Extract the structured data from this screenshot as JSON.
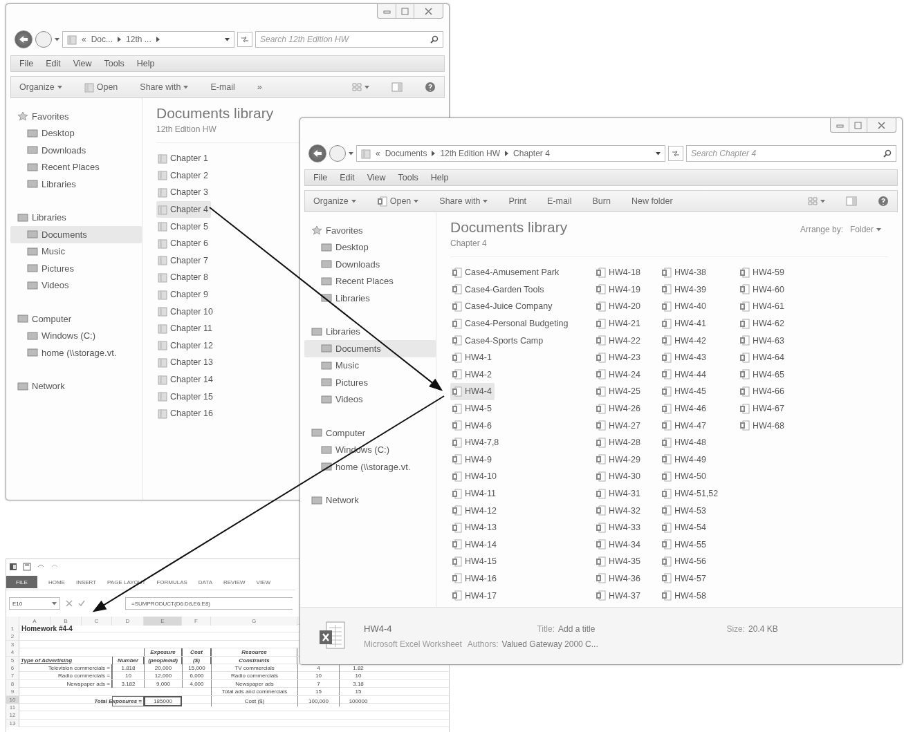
{
  "explorer_windows": [
    {
      "address": {
        "overflow": "«",
        "parts": [
          "Doc...",
          "12th ..."
        ],
        "trailing_separator": true
      },
      "search": {
        "placeholder": "Search 12th Edition HW"
      },
      "menu": [
        "File",
        "Edit",
        "View",
        "Tools",
        "Help"
      ],
      "toolbar": [
        {
          "label": "Organize",
          "dropdown": true,
          "kind": "plain"
        },
        {
          "label": "Open",
          "dropdown": false,
          "kind": "folder"
        },
        {
          "label": "Share with",
          "dropdown": true,
          "kind": "plain"
        },
        {
          "label": "E-mail",
          "dropdown": false,
          "kind": "plain"
        },
        {
          "label": "»",
          "dropdown": false,
          "kind": "plain"
        }
      ],
      "nav_groups": [
        {
          "label": "Favorites",
          "selected": false,
          "items": [
            {
              "label": "Desktop",
              "selected": false
            },
            {
              "label": "Downloads",
              "selected": false
            },
            {
              "label": "Recent Places",
              "selected": false
            },
            {
              "label": "Libraries",
              "selected": false
            }
          ]
        },
        {
          "label": "Libraries",
          "selected": false,
          "items": [
            {
              "label": "Documents",
              "selected": true
            },
            {
              "label": "Music",
              "selected": false
            },
            {
              "label": "Pictures",
              "selected": false
            },
            {
              "label": "Videos",
              "selected": false
            }
          ]
        },
        {
          "label": "Computer",
          "selected": false,
          "items": [
            {
              "label": "Windows (C:)",
              "selected": false
            },
            {
              "label": "home (\\\\storage.vt.",
              "selected": false
            }
          ]
        },
        {
          "label": "Network",
          "selected": false
        }
      ],
      "library_title": "Documents library",
      "library_subtitle": "12th Edition HW",
      "file_columns": [
        [
          {
            "name": "Chapter 1",
            "kind": "folder",
            "selected": false
          },
          {
            "name": "Chapter 2",
            "kind": "folder",
            "selected": false
          },
          {
            "name": "Chapter 3",
            "kind": "folder",
            "selected": false
          },
          {
            "name": "Chapter 4",
            "kind": "folder",
            "selected": true
          },
          {
            "name": "Chapter 5",
            "kind": "folder",
            "selected": false
          },
          {
            "name": "Chapter 6",
            "kind": "folder",
            "selected": false
          },
          {
            "name": "Chapter 7",
            "kind": "folder",
            "selected": false
          },
          {
            "name": "Chapter 8",
            "kind": "folder",
            "selected": false
          },
          {
            "name": "Chapter 9",
            "kind": "folder",
            "selected": false
          },
          {
            "name": "Chapter 10",
            "kind": "folder",
            "selected": false
          },
          {
            "name": "Chapter 11",
            "kind": "folder",
            "selected": false
          },
          {
            "name": "Chapter 12",
            "kind": "folder",
            "selected": false
          },
          {
            "name": "Chapter 13",
            "kind": "folder",
            "selected": false
          },
          {
            "name": "Chapter 14",
            "kind": "folder",
            "selected": false
          },
          {
            "name": "Chapter 15",
            "kind": "folder",
            "selected": false
          },
          {
            "name": "Chapter 16",
            "kind": "folder",
            "selected": false
          }
        ]
      ]
    },
    {
      "address": {
        "overflow": "«",
        "parts": [
          "Documents",
          "12th Edition HW",
          "Chapter 4"
        ],
        "trailing_separator": false
      },
      "search": {
        "placeholder": "Search Chapter 4"
      },
      "menu": [
        "File",
        "Edit",
        "View",
        "Tools",
        "Help"
      ],
      "toolbar": [
        {
          "label": "Organize",
          "dropdown": true,
          "kind": "plain"
        },
        {
          "label": "Open",
          "dropdown": true,
          "kind": "workbook"
        },
        {
          "label": "Share with",
          "dropdown": true,
          "kind": "plain"
        },
        {
          "label": "Print",
          "dropdown": false,
          "kind": "plain"
        },
        {
          "label": "E-mail",
          "dropdown": false,
          "kind": "plain"
        },
        {
          "label": "Burn",
          "dropdown": false,
          "kind": "plain"
        },
        {
          "label": "New folder",
          "dropdown": false,
          "kind": "plain"
        }
      ],
      "nav_groups": [
        {
          "label": "Favorites",
          "selected": false,
          "items": [
            {
              "label": "Desktop",
              "selected": false
            },
            {
              "label": "Downloads",
              "selected": false
            },
            {
              "label": "Recent Places",
              "selected": false
            },
            {
              "label": "Libraries",
              "selected": false
            }
          ]
        },
        {
          "label": "Libraries",
          "selected": false,
          "items": [
            {
              "label": "Documents",
              "selected": true
            },
            {
              "label": "Music",
              "selected": false
            },
            {
              "label": "Pictures",
              "selected": false
            },
            {
              "label": "Videos",
              "selected": false
            }
          ]
        },
        {
          "label": "Computer",
          "selected": false,
          "items": [
            {
              "label": "Windows (C:)",
              "selected": false
            },
            {
              "label": "home (\\\\storage.vt.",
              "selected": false
            }
          ]
        },
        {
          "label": "Network",
          "selected": false
        }
      ],
      "library_title": "Documents library",
      "library_subtitle": "Chapter 4",
      "arrange": {
        "label": "Arrange by:",
        "value": "Folder"
      },
      "file_columns": [
        [
          {
            "name": "Case4-Amusement Park",
            "kind": "workbook",
            "selected": false
          },
          {
            "name": "Case4-Garden Tools",
            "kind": "workbook",
            "selected": false
          },
          {
            "name": "Case4-Juice Company",
            "kind": "workbook",
            "selected": false
          },
          {
            "name": "Case4-Personal Budgeting",
            "kind": "workbook",
            "selected": false
          },
          {
            "name": "Case4-Sports Camp",
            "kind": "workbook",
            "selected": false
          },
          {
            "name": "HW4-1",
            "kind": "workbook",
            "selected": false
          },
          {
            "name": "HW4-2",
            "kind": "workbook",
            "selected": false
          },
          {
            "name": "HW4-4",
            "kind": "workbook",
            "selected": true
          },
          {
            "name": "HW4-5",
            "kind": "workbook",
            "selected": false
          },
          {
            "name": "HW4-6",
            "kind": "workbook",
            "selected": false
          },
          {
            "name": "HW4-7,8",
            "kind": "workbook",
            "selected": false
          },
          {
            "name": "HW4-9",
            "kind": "workbook",
            "selected": false
          },
          {
            "name": "HW4-10",
            "kind": "workbook",
            "selected": false
          },
          {
            "name": "HW4-11",
            "kind": "workbook",
            "selected": false
          },
          {
            "name": "HW4-12",
            "kind": "workbook",
            "selected": false
          },
          {
            "name": "HW4-13",
            "kind": "workbook",
            "selected": false
          },
          {
            "name": "HW4-14",
            "kind": "workbook",
            "selected": false
          },
          {
            "name": "HW4-15",
            "kind": "workbook",
            "selected": false
          },
          {
            "name": "HW4-16",
            "kind": "workbook",
            "selected": false
          },
          {
            "name": "HW4-17",
            "kind": "workbook",
            "selected": false
          }
        ],
        [
          {
            "name": "HW4-18",
            "kind": "workbook",
            "selected": false
          },
          {
            "name": "HW4-19",
            "kind": "workbook",
            "selected": false
          },
          {
            "name": "HW4-20",
            "kind": "workbook",
            "selected": false
          },
          {
            "name": "HW4-21",
            "kind": "workbook",
            "selected": false
          },
          {
            "name": "HW4-22",
            "kind": "workbook",
            "selected": false
          },
          {
            "name": "HW4-23",
            "kind": "workbook",
            "selected": false
          },
          {
            "name": "HW4-24",
            "kind": "workbook",
            "selected": false
          },
          {
            "name": "HW4-25",
            "kind": "workbook",
            "selected": false
          },
          {
            "name": "HW4-26",
            "kind": "workbook",
            "selected": false
          },
          {
            "name": "HW4-27",
            "kind": "workbook",
            "selected": false
          },
          {
            "name": "HW4-28",
            "kind": "workbook",
            "selected": false
          },
          {
            "name": "HW4-29",
            "kind": "workbook",
            "selected": false
          },
          {
            "name": "HW4-30",
            "kind": "workbook",
            "selected": false
          },
          {
            "name": "HW4-31",
            "kind": "workbook",
            "selected": false
          },
          {
            "name": "HW4-32",
            "kind": "workbook",
            "selected": false
          },
          {
            "name": "HW4-33",
            "kind": "workbook",
            "selected": false
          },
          {
            "name": "HW4-34",
            "kind": "workbook",
            "selected": false
          },
          {
            "name": "HW4-35",
            "kind": "workbook",
            "selected": false
          },
          {
            "name": "HW4-36",
            "kind": "workbook",
            "selected": false
          },
          {
            "name": "HW4-37",
            "kind": "workbook",
            "selected": false
          }
        ],
        [
          {
            "name": "HW4-38",
            "kind": "workbook",
            "selected": false
          },
          {
            "name": "HW4-39",
            "kind": "workbook",
            "selected": false
          },
          {
            "name": "HW4-40",
            "kind": "workbook",
            "selected": false
          },
          {
            "name": "HW4-41",
            "kind": "workbook",
            "selected": false
          },
          {
            "name": "HW4-42",
            "kind": "workbook",
            "selected": false
          },
          {
            "name": "HW4-43",
            "kind": "workbook",
            "selected": false
          },
          {
            "name": "HW4-44",
            "kind": "workbook",
            "selected": false
          },
          {
            "name": "HW4-45",
            "kind": "workbook",
            "selected": false
          },
          {
            "name": "HW4-46",
            "kind": "workbook",
            "selected": false
          },
          {
            "name": "HW4-47",
            "kind": "workbook",
            "selected": false
          },
          {
            "name": "HW4-48",
            "kind": "workbook",
            "selected": false
          },
          {
            "name": "HW4-49",
            "kind": "workbook",
            "selected": false
          },
          {
            "name": "HW4-50",
            "kind": "workbook",
            "selected": false
          },
          {
            "name": "HW4-51,52",
            "kind": "workbook",
            "selected": false
          },
          {
            "name": "HW4-53",
            "kind": "workbook",
            "selected": false
          },
          {
            "name": "HW4-54",
            "kind": "workbook",
            "selected": false
          },
          {
            "name": "HW4-55",
            "kind": "workbook",
            "selected": false
          },
          {
            "name": "HW4-56",
            "kind": "workbook",
            "selected": false
          },
          {
            "name": "HW4-57",
            "kind": "workbook",
            "selected": false
          },
          {
            "name": "HW4-58",
            "kind": "workbook",
            "selected": false
          }
        ],
        [
          {
            "name": "HW4-59",
            "kind": "workbook",
            "selected": false
          },
          {
            "name": "HW4-60",
            "kind": "workbook",
            "selected": false
          },
          {
            "name": "HW4-61",
            "kind": "workbook",
            "selected": false
          },
          {
            "name": "HW4-62",
            "kind": "workbook",
            "selected": false
          },
          {
            "name": "HW4-63",
            "kind": "workbook",
            "selected": false
          },
          {
            "name": "HW4-64",
            "kind": "workbook",
            "selected": false
          },
          {
            "name": "HW4-65",
            "kind": "workbook",
            "selected": false
          },
          {
            "name": "HW4-66",
            "kind": "workbook",
            "selected": false
          },
          {
            "name": "HW4-67",
            "kind": "workbook",
            "selected": false
          },
          {
            "name": "HW4-68",
            "kind": "workbook",
            "selected": false
          }
        ]
      ],
      "details": {
        "name": "HW4-4",
        "type": "Microsoft Excel Worksheet",
        "fields": [
          {
            "label": "Title:",
            "value": "Add a title"
          },
          {
            "label": "Authors:",
            "value": "Valued Gateway 2000 C..."
          },
          {
            "label": "Size:",
            "value": "20.4 KB"
          }
        ]
      }
    }
  ],
  "spreadsheet": {
    "file_tab": "FILE",
    "tabs": [
      "HOME",
      "INSERT",
      "PAGE LAYOUT",
      "FORMULAS",
      "DATA",
      "REVIEW",
      "VIEW"
    ],
    "name_box": "E10",
    "formula": "=SUMPRODUCT(D6:D8,E6:E8)",
    "columns": [
      {
        "label": "A",
        "selected": false
      },
      {
        "label": "B",
        "selected": false
      },
      {
        "label": "C",
        "selected": false
      },
      {
        "label": "D",
        "selected": false
      },
      {
        "label": "E",
        "selected": true
      },
      {
        "label": "F",
        "selected": false
      },
      {
        "label": "G",
        "selected": false
      }
    ],
    "rows": [
      {
        "number": "1",
        "selected": false,
        "cells": [
          {
            "text": "Homework #4-4",
            "kind": "title"
          }
        ]
      },
      {
        "number": "2",
        "selected": false,
        "cells": []
      },
      {
        "number": "3",
        "selected": false,
        "cells": []
      },
      {
        "number": "4",
        "selected": false,
        "cells": [
          "",
          "",
          "",
          "",
          {
            "text": "Exposure",
            "kind": "head"
          },
          {
            "text": "Cost",
            "kind": "head"
          },
          {
            "text": "Resource",
            "kind": "head"
          }
        ]
      },
      {
        "number": "5",
        "selected": false,
        "cells": [
          {
            "text": "Type of Advertising",
            "kind": "headleft"
          },
          "",
          "",
          {
            "text": "Number",
            "kind": "head"
          },
          {
            "text": "(people/ad)",
            "kind": "head"
          },
          {
            "text": "($)",
            "kind": "head"
          },
          {
            "text": "Constraints",
            "kind": "head"
          }
        ]
      },
      {
        "number": "6",
        "selected": false,
        "cells": [
          "",
          "",
          {
            "text": "Television commercials =",
            "kind": "label"
          },
          {
            "text": "1.818",
            "kind": "value"
          },
          {
            "text": "20,000",
            "kind": "value"
          },
          {
            "text": "15,000",
            "kind": "value"
          },
          {
            "text": "TV commercials",
            "kind": "value"
          },
          {
            "text": "4",
            "kind": "value"
          },
          {
            "text": "1.82",
            "kind": "value"
          }
        ]
      },
      {
        "number": "7",
        "selected": false,
        "cells": [
          "",
          "",
          {
            "text": "Radio commercials =",
            "kind": "label"
          },
          {
            "text": "10",
            "kind": "value"
          },
          {
            "text": "12,000",
            "kind": "value"
          },
          {
            "text": "6,000",
            "kind": "value"
          },
          {
            "text": "Radio commercials",
            "kind": "value"
          },
          {
            "text": "10",
            "kind": "value"
          },
          {
            "text": "10",
            "kind": "value"
          }
        ]
      },
      {
        "number": "8",
        "selected": false,
        "cells": [
          "",
          "",
          {
            "text": "Newspaper ads =",
            "kind": "label"
          },
          {
            "text": "3.182",
            "kind": "value"
          },
          {
            "text": "9,000",
            "kind": "value"
          },
          {
            "text": "4,000",
            "kind": "value"
          },
          {
            "text": "Newspaper ads",
            "kind": "value"
          },
          {
            "text": "7",
            "kind": "value"
          },
          {
            "text": "3.18",
            "kind": "value"
          }
        ]
      },
      {
        "number": "9",
        "selected": false,
        "cells": [
          "",
          "",
          "",
          "",
          "",
          "",
          {
            "text": "Total ads and commercials",
            "kind": "value"
          },
          {
            "text": "15",
            "kind": "value"
          },
          {
            "text": "15",
            "kind": "value"
          }
        ]
      },
      {
        "number": "10",
        "selected": true,
        "cells": [
          "",
          "",
          "",
          {
            "text": "Total Exposures =",
            "kind": "total"
          },
          {
            "text": "185000",
            "kind": "active"
          },
          "",
          {
            "text": "Cost ($)",
            "kind": "value"
          },
          {
            "text": "100,000",
            "kind": "value"
          },
          {
            "text": "100000",
            "kind": "value"
          }
        ]
      },
      {
        "number": "11",
        "selected": false,
        "cells": []
      },
      {
        "number": "12",
        "selected": false,
        "cells": []
      },
      {
        "number": "13",
        "selected": false,
        "cells": []
      }
    ]
  }
}
